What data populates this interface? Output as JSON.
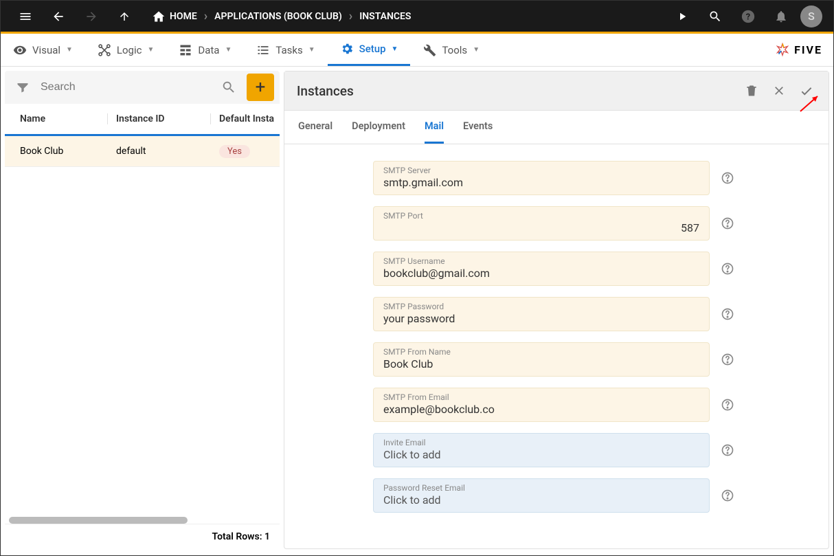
{
  "breadcrumb": {
    "home": "HOME",
    "app": "APPLICATIONS (BOOK CLUB)",
    "page": "INSTANCES"
  },
  "avatar_initial": "S",
  "menu": {
    "visual": "Visual",
    "logic": "Logic",
    "data": "Data",
    "tasks": "Tasks",
    "setup": "Setup",
    "tools": "Tools"
  },
  "logo_text": "FIVE",
  "search": {
    "placeholder": "Search"
  },
  "table": {
    "columns": {
      "c1": "Name",
      "c2": "Instance ID",
      "c3": "Default Insta"
    },
    "row": {
      "name": "Book Club",
      "id": "default",
      "def": "Yes"
    },
    "total_label": "Total Rows: 1"
  },
  "panel": {
    "title": "Instances",
    "tabs": {
      "general": "General",
      "deployment": "Deployment",
      "mail": "Mail",
      "events": "Events"
    }
  },
  "fields": {
    "server": {
      "label": "SMTP Server",
      "value": "smtp.gmail.com"
    },
    "port": {
      "label": "SMTP Port",
      "value": "587"
    },
    "username": {
      "label": "SMTP Username",
      "value": "bookclub@gmail.com"
    },
    "password": {
      "label": "SMTP Password",
      "value": "your password"
    },
    "fromname": {
      "label": "SMTP From Name",
      "value": "Book Club"
    },
    "fromemail": {
      "label": "SMTP From Email",
      "value": "example@bookclub.co"
    },
    "invite": {
      "label": "Invite Email",
      "value": "Click to add"
    },
    "reset": {
      "label": "Password Reset Email",
      "value": "Click to add"
    }
  }
}
